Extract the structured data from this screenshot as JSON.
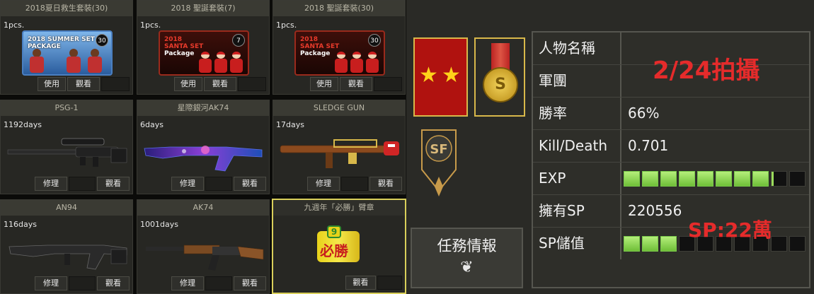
{
  "inventory": {
    "items": [
      {
        "title": "2018夏日救生套裝(30)",
        "qty": "1pcs.",
        "btn1": "使用",
        "btn2": "觀看",
        "pkg_line1": "2018 SUMMER SET",
        "pkg_line2": "PACKAGE",
        "pkg_num": "30"
      },
      {
        "title": "2018 聖誕套裝(7)",
        "qty": "1pcs.",
        "btn1": "使用",
        "btn2": "觀看",
        "pkg_line1": "2018",
        "pkg_line2": "SANTA SET",
        "pkg_line3": "Package",
        "pkg_num": "7"
      },
      {
        "title": "2018 聖誕套裝(30)",
        "qty": "1pcs.",
        "btn1": "使用",
        "btn2": "觀看",
        "pkg_line1": "2018",
        "pkg_line2": "SANTA SET",
        "pkg_line3": "Package",
        "pkg_num": "30"
      },
      {
        "title": "PSG-1",
        "qty": "1192days",
        "btn1": "修理",
        "btn2": "觀看"
      },
      {
        "title": "星際銀河AK74",
        "qty": "6days",
        "btn1": "修理",
        "btn2": "觀看"
      },
      {
        "title": "SLEDGE GUN",
        "qty": "17days",
        "btn1": "修理",
        "btn2": "觀看"
      },
      {
        "title": "AN94",
        "qty": "116days",
        "btn1": "修理",
        "btn2": "觀看"
      },
      {
        "title": "AK74",
        "qty": "1001days",
        "btn1": "修理",
        "btn2": "觀看"
      },
      {
        "title": "九週年「必勝」臂章",
        "qty": "",
        "btn2": "觀看",
        "badge_text": "必勝",
        "badge_num": "9"
      }
    ]
  },
  "profile": {
    "emblem_text": "SF",
    "medal_letter": "S",
    "mission_label": "任務情報",
    "rows": {
      "name_label": "人物名稱",
      "corps_label": "軍團",
      "winrate_label": "勝率",
      "winrate_value": "66%",
      "kd_label": "Kill/Death",
      "kd_value": "0.701",
      "exp_label": "EXP",
      "exp_segments": 10,
      "exp_filled": 8,
      "sp_label": "擁有SP",
      "sp_value": "220556",
      "sp_recharge_label": "SP儲值",
      "sp_recharge_segments": 10,
      "sp_recharge_filled": 3
    },
    "annotation_date": "2/24拍攝",
    "annotation_sp": "SP:22萬"
  },
  "colors": {
    "annotation": "#e52b2b",
    "bar_fill": "#8fd450",
    "rank_bg": "#b0120f",
    "selected_border": "#d9cf5a"
  }
}
